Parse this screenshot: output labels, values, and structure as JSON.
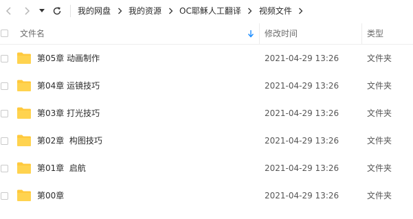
{
  "nav": {
    "back_icon": "chevron-left-icon",
    "forward_icon": "chevron-right-icon",
    "history_icon": "caret-down-icon",
    "refresh_icon": "refresh-icon"
  },
  "breadcrumb": [
    "我的网盘",
    "我的资源",
    "OC耶稣人工翻译",
    "视频文件"
  ],
  "columns": {
    "name": "文件名",
    "modified": "修改时间",
    "type": "类型"
  },
  "sort": {
    "column": "name",
    "icon": "sort-down-arrow-icon",
    "color": "#1a8cff"
  },
  "folder_color": "#ffc93d",
  "files": [
    {
      "name": "第05章 动画制作",
      "modified": "2021-04-29 13:26",
      "type": "文件夹"
    },
    {
      "name": "第04章 运镜技巧",
      "modified": "2021-04-29 13:26",
      "type": "文件夹"
    },
    {
      "name": "第03章 打光技巧",
      "modified": "2021-04-29 13:26",
      "type": "文件夹"
    },
    {
      "name": "第02章  构图技巧",
      "modified": "2021-04-29 13:26",
      "type": "文件夹"
    },
    {
      "name": "第01章  启航",
      "modified": "2021-04-29 13:26",
      "type": "文件夹"
    },
    {
      "name": "第00章",
      "modified": "2021-04-29 13:26",
      "type": "文件夹"
    }
  ]
}
